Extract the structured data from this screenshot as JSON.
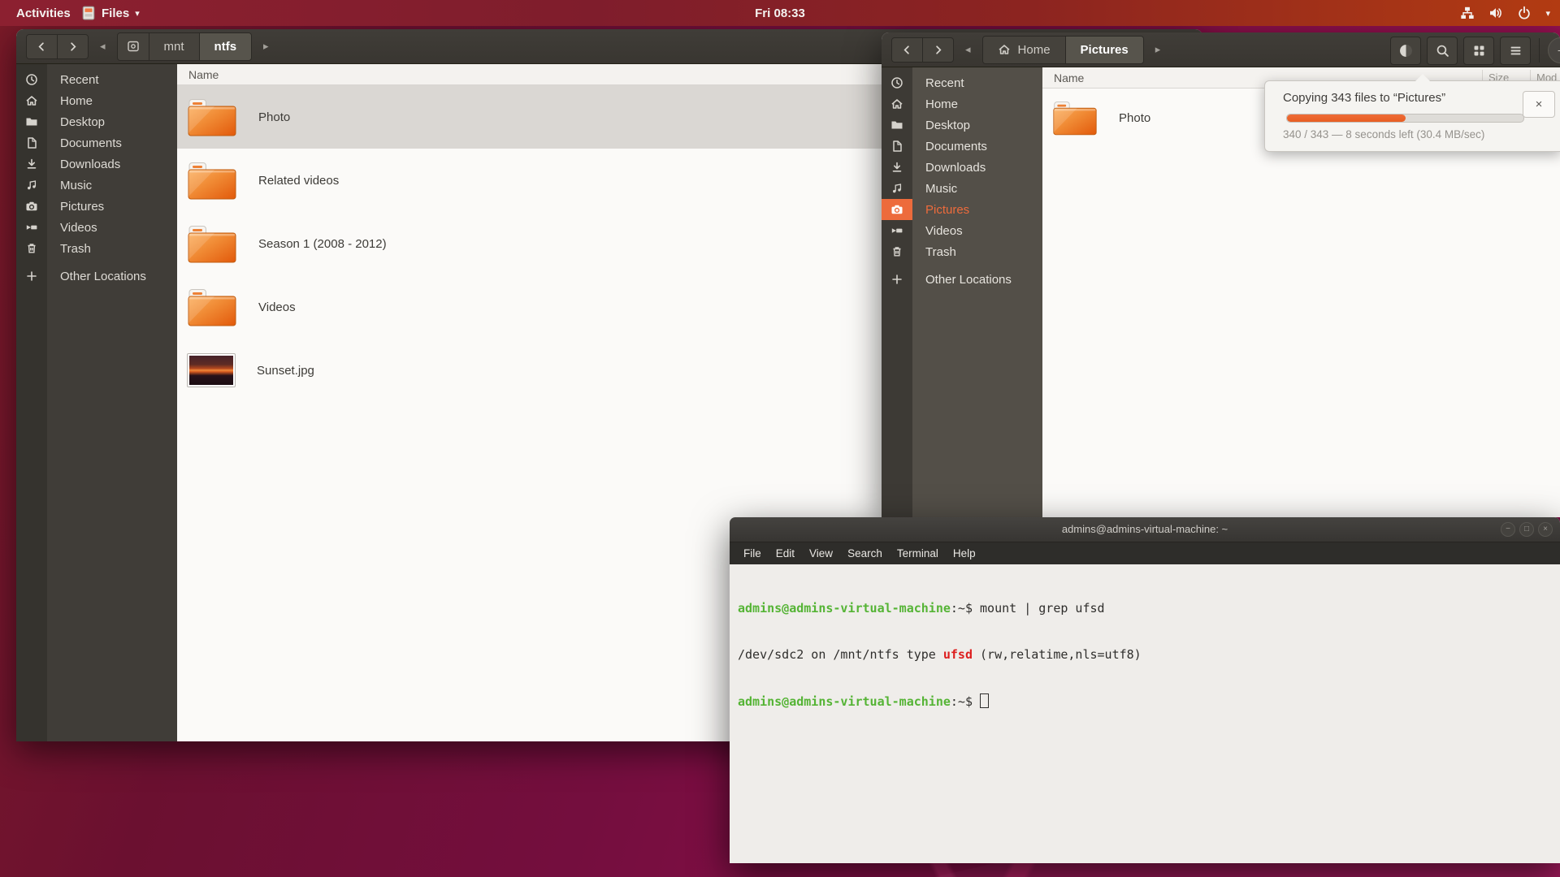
{
  "colors": {
    "accent_orange": "#E95420",
    "progress_fill": "#EE6C38",
    "selection_row": "#DAD7D3",
    "sidebar_active": "#ED6B3C",
    "prompt_green": "#55B435",
    "grep_red": "#DD1F1F",
    "topbar_left": "#8C2030",
    "topbar_right": "#B23B12"
  },
  "icons": {
    "chevron_down": "▾",
    "breadcrumb_prev": "◂",
    "breadcrumb_next": "▸",
    "popup_close": "×",
    "term_minimize": "−",
    "term_maximize": "□",
    "term_close": "×"
  },
  "topbar": {
    "activities": "Activities",
    "app_name": "Files",
    "clock": "Fri 08:33"
  },
  "places": [
    "Recent",
    "Home",
    "Desktop",
    "Documents",
    "Downloads",
    "Music",
    "Pictures",
    "Videos",
    "Trash",
    "Other Locations"
  ],
  "left_window": {
    "breadcrumb": {
      "mnt": "mnt",
      "ntfs": "ntfs"
    },
    "column_name": "Name",
    "files": [
      {
        "name": "Photo",
        "type": "folder",
        "selected": true
      },
      {
        "name": "Related videos",
        "type": "folder"
      },
      {
        "name": "Season 1 (2008 - 2012)",
        "type": "folder"
      },
      {
        "name": "Videos",
        "type": "folder"
      },
      {
        "name": "Sunset.jpg",
        "type": "image"
      }
    ]
  },
  "right_window": {
    "breadcrumb": {
      "home": "Home",
      "pictures": "Pictures"
    },
    "column_name": "Name",
    "column_size": "Size",
    "column_modified": "Modified",
    "files": [
      {
        "name": "Photo",
        "type": "folder"
      }
    ]
  },
  "copy_popup": {
    "title": "Copying 343 files to “Pictures”",
    "detail": "340 / 343 — 8 seconds left (30.4 MB/sec)",
    "progress_percent": 50
  },
  "terminal": {
    "title": "admins@admins-virtual-machine: ~",
    "menu": [
      "File",
      "Edit",
      "View",
      "Search",
      "Terminal",
      "Help"
    ],
    "prompt_user": "admins@admins-virtual-machine",
    "prompt_suffix": ":~$",
    "line1_command": " mount | grep ufsd",
    "line2_pre": "/dev/sdc2 on /mnt/ntfs type ",
    "line2_match": "ufsd",
    "line2_post": " (rw,relatime,nls=utf8)"
  }
}
